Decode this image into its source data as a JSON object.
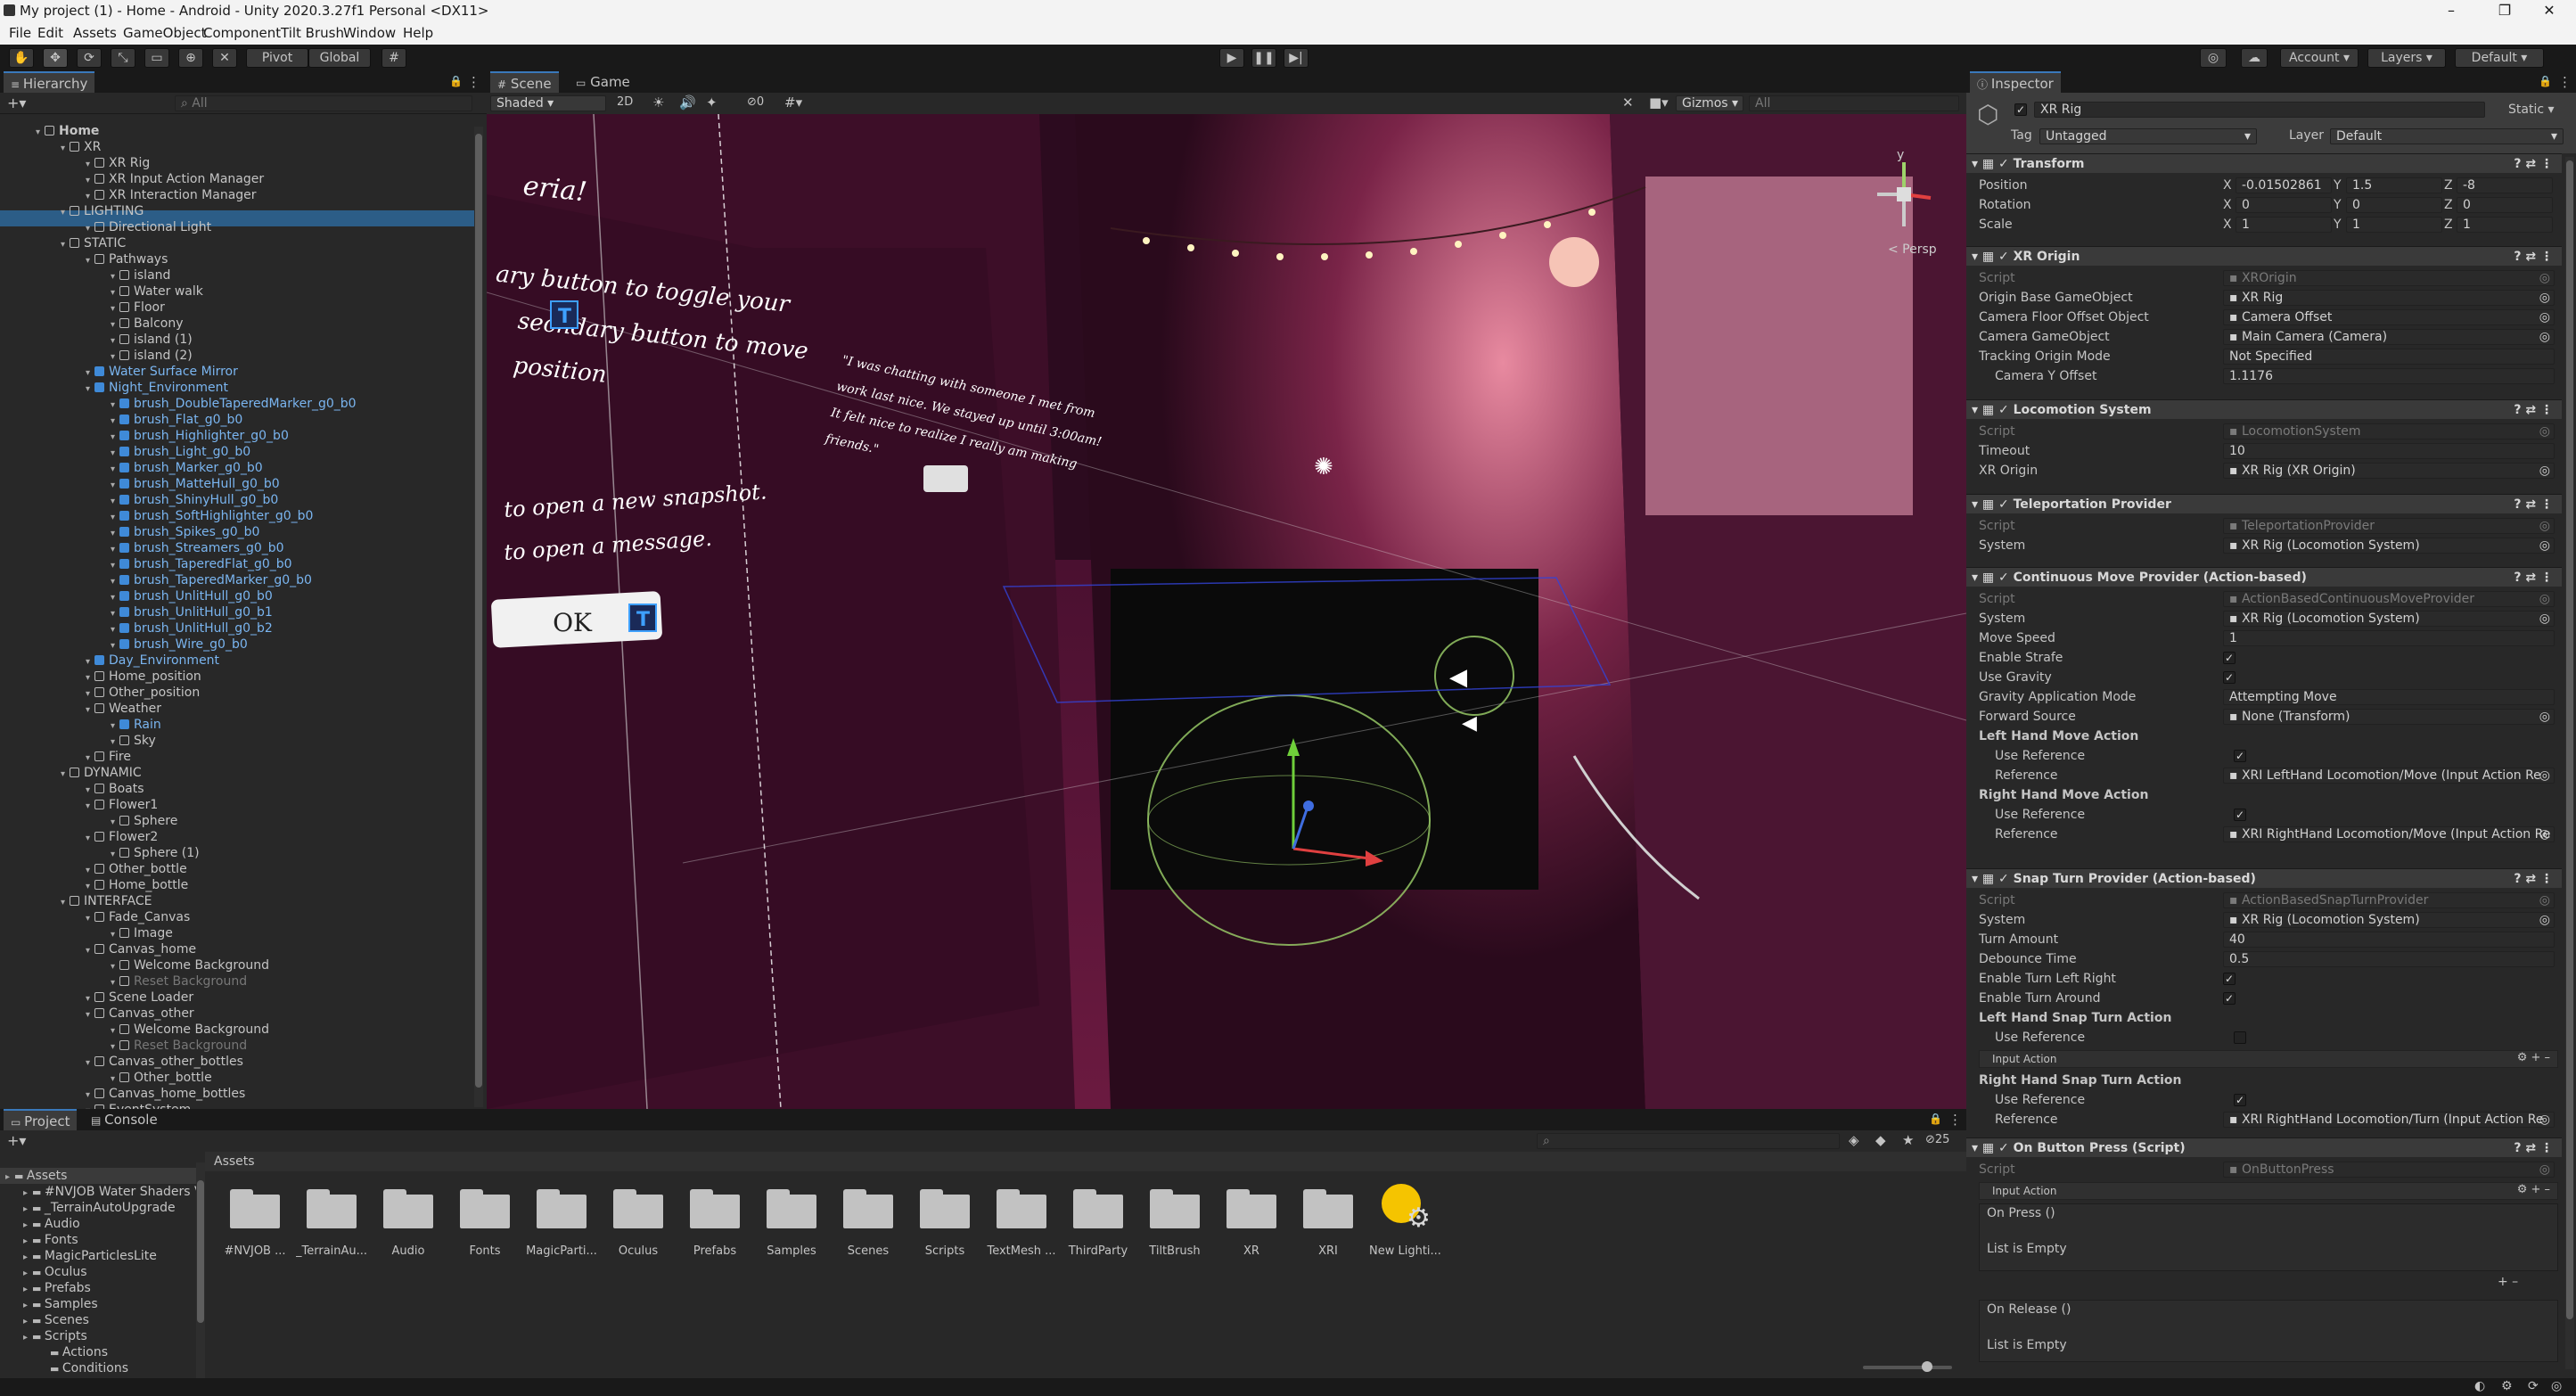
{
  "window": {
    "title": "My project (1) - Home - Android - Unity 2020.3.27f1 Personal <DX11>"
  },
  "menu": [
    "File",
    "Edit",
    "Assets",
    "GameObject",
    "Component",
    "Tilt Brush",
    "Window",
    "Help"
  ],
  "toolbar": {
    "pivot": "Pivot",
    "global": "Global",
    "account": "Account",
    "layers": "Layers",
    "layout": "Default"
  },
  "hierarchy": {
    "tab": "Hierarchy",
    "search_placeholder": "All",
    "rows": [
      {
        "t": "Home",
        "i": 0,
        "b": 1
      },
      {
        "t": "XR",
        "i": 1
      },
      {
        "t": "XR Rig",
        "i": 2,
        "s": 1
      },
      {
        "t": "XR Input Action Manager",
        "i": 2
      },
      {
        "t": "XR Interaction Manager",
        "i": 2
      },
      {
        "t": "LIGHTING",
        "i": 1
      },
      {
        "t": "Directional Light",
        "i": 2
      },
      {
        "t": "STATIC",
        "i": 1
      },
      {
        "t": "Pathways",
        "i": 2
      },
      {
        "t": "island",
        "i": 3
      },
      {
        "t": "Water walk",
        "i": 3
      },
      {
        "t": "Floor",
        "i": 3
      },
      {
        "t": "Balcony",
        "i": 3
      },
      {
        "t": "island (1)",
        "i": 3
      },
      {
        "t": "island (2)",
        "i": 3
      },
      {
        "t": "Water Surface Mirror",
        "i": 2,
        "c": "blue"
      },
      {
        "t": "Night_Environment",
        "i": 2,
        "c": "blue"
      },
      {
        "t": "brush_DoubleTaperedMarker_g0_b0",
        "i": 3,
        "c": "blue"
      },
      {
        "t": "brush_Flat_g0_b0",
        "i": 3,
        "c": "blue"
      },
      {
        "t": "brush_Highlighter_g0_b0",
        "i": 3,
        "c": "blue"
      },
      {
        "t": "brush_Light_g0_b0",
        "i": 3,
        "c": "blue"
      },
      {
        "t": "brush_Marker_g0_b0",
        "i": 3,
        "c": "blue"
      },
      {
        "t": "brush_MatteHull_g0_b0",
        "i": 3,
        "c": "blue"
      },
      {
        "t": "brush_ShinyHull_g0_b0",
        "i": 3,
        "c": "blue"
      },
      {
        "t": "brush_SoftHighlighter_g0_b0",
        "i": 3,
        "c": "blue"
      },
      {
        "t": "brush_Spikes_g0_b0",
        "i": 3,
        "c": "blue"
      },
      {
        "t": "brush_Streamers_g0_b0",
        "i": 3,
        "c": "blue"
      },
      {
        "t": "brush_TaperedFlat_g0_b0",
        "i": 3,
        "c": "blue"
      },
      {
        "t": "brush_TaperedMarker_g0_b0",
        "i": 3,
        "c": "blue"
      },
      {
        "t": "brush_UnlitHull_g0_b0",
        "i": 3,
        "c": "blue"
      },
      {
        "t": "brush_UnlitHull_g0_b1",
        "i": 3,
        "c": "blue"
      },
      {
        "t": "brush_UnlitHull_g0_b2",
        "i": 3,
        "c": "blue"
      },
      {
        "t": "brush_Wire_g0_b0",
        "i": 3,
        "c": "blue"
      },
      {
        "t": "Day_Environment",
        "i": 2,
        "c": "blue"
      },
      {
        "t": "Home_position",
        "i": 2
      },
      {
        "t": "Other_position",
        "i": 2
      },
      {
        "t": "Weather",
        "i": 2
      },
      {
        "t": "Rain",
        "i": 3,
        "c": "blue"
      },
      {
        "t": "Sky",
        "i": 3
      },
      {
        "t": "Fire",
        "i": 2
      },
      {
        "t": "DYNAMIC",
        "i": 1
      },
      {
        "t": "Boats",
        "i": 2
      },
      {
        "t": "Flower1",
        "i": 2
      },
      {
        "t": "Sphere",
        "i": 3
      },
      {
        "t": "Flower2",
        "i": 2
      },
      {
        "t": "Sphere (1)",
        "i": 3
      },
      {
        "t": "Other_bottle",
        "i": 2
      },
      {
        "t": "Home_bottle",
        "i": 2
      },
      {
        "t": "INTERFACE",
        "i": 1
      },
      {
        "t": "Fade_Canvas",
        "i": 2
      },
      {
        "t": "Image",
        "i": 3
      },
      {
        "t": "Canvas_home",
        "i": 2
      },
      {
        "t": "Welcome Background",
        "i": 3
      },
      {
        "t": "Reset Background",
        "i": 3,
        "c": "dim"
      },
      {
        "t": "Scene Loader",
        "i": 2
      },
      {
        "t": "Canvas_other",
        "i": 2
      },
      {
        "t": "Welcome Background",
        "i": 3
      },
      {
        "t": "Reset Background",
        "i": 3,
        "c": "dim"
      },
      {
        "t": "Canvas_other_bottles",
        "i": 2
      },
      {
        "t": "Other_bottle",
        "i": 3
      },
      {
        "t": "Canvas_home_bottles",
        "i": 2
      },
      {
        "t": "EventSystem",
        "i": 2
      }
    ]
  },
  "scene": {
    "tab_scene": "Scene",
    "tab_game": "Game",
    "shading": "Shaded",
    "mode_2d": "2D",
    "gizmos": "Gizmos",
    "search_placeholder": "All",
    "hidden_count": "0",
    "persp": "< Persp",
    "texts": [
      "eria!",
      "ary button to toggle your",
      "secndary button to move",
      "position",
      "to open a new snapshot.",
      "to open a message.",
      "OK"
    ],
    "note": [
      "\"I was chatting with someone I met from",
      "work last nice. We stayed up until 3:00am!",
      "It felt nice to realize I really am making",
      "friends.\""
    ]
  },
  "inspector": {
    "tab": "Inspector",
    "object_name": "XR Rig",
    "static": "Static",
    "tag_label": "Tag",
    "tag": "Untagged",
    "layer_label": "Layer",
    "layer": "Default",
    "transform": {
      "title": "Transform",
      "position": "Position",
      "rotation": "Rotation",
      "scale": "Scale",
      "px": "-0.01502861",
      "py": "1.5",
      "pz": "-8",
      "rx": "0",
      "ry": "0",
      "rz": "0",
      "sx": "1",
      "sy": "1",
      "sz": "1"
    },
    "xr_origin": {
      "title": "XR Origin",
      "script_l": "Script",
      "script": "XROrigin",
      "r1": "Origin Base GameObject",
      "v1": "XR Rig",
      "r2": "Camera Floor Offset Object",
      "v2": "Camera Offset",
      "r3": "Camera GameObject",
      "v3": "Main Camera (Camera)",
      "r4": "Tracking Origin Mode",
      "v4": "Not Specified",
      "r5": "Camera Y Offset",
      "v5": "1.1176"
    },
    "locomotion": {
      "title": "Locomotion System",
      "script_l": "Script",
      "script": "LocomotionSystem",
      "r1": "Timeout",
      "v1": "10",
      "r2": "XR Origin",
      "v2": "XR Rig (XR Origin)"
    },
    "teleport": {
      "title": "Teleportation Provider",
      "script_l": "Script",
      "script": "TeleportationProvider",
      "r1": "System",
      "v1": "XR Rig (Locomotion System)"
    },
    "move": {
      "title": "Continuous Move Provider (Action-based)",
      "script_l": "Script",
      "script": "ActionBasedContinuousMoveProvider",
      "r1": "System",
      "v1": "XR Rig (Locomotion System)",
      "r2": "Move Speed",
      "v2": "1",
      "r3": "Enable Strafe",
      "r4": "Use Gravity",
      "r5": "Gravity Application Mode",
      "v5": "Attempting Move",
      "r6": "Forward Source",
      "v6": "None (Transform)",
      "h1": "Left Hand Move Action",
      "r7": "Use Reference",
      "r8": "Reference",
      "v8": "XRI LeftHand Locomotion/Move (Input Action Re",
      "h2": "Right Hand Move Action",
      "r9": "Use Reference",
      "r10": "Reference",
      "v10": "XRI RightHand Locomotion/Move (Input Action Re"
    },
    "snap": {
      "title": "Snap Turn Provider (Action-based)",
      "script_l": "Script",
      "script": "ActionBasedSnapTurnProvider",
      "r1": "System",
      "v1": "XR Rig (Locomotion System)",
      "r2": "Turn Amount",
      "v2": "40",
      "r3": "Debounce Time",
      "v3": "0.5",
      "r4": "Enable Turn Left Right",
      "r5": "Enable Turn Around",
      "h1": "Left Hand Snap Turn Action",
      "r6": "Use Reference",
      "r7": "Input Action",
      "h2": "Right Hand Snap Turn Action",
      "r8": "Use Reference",
      "r9": "Reference",
      "v9": "XRI RightHand Locomotion/Turn (Input Action Re"
    },
    "button": {
      "title": "On Button Press (Script)",
      "script_l": "Script",
      "script": "OnButtonPress",
      "r1": "Input Action",
      "r2": "On Press ()",
      "r3": "List is Empty",
      "r4": "On Release ()",
      "r5": "List is Empty"
    }
  },
  "project": {
    "tab_project": "Project",
    "tab_console": "Console",
    "breadcrumb": "Assets",
    "count": "25",
    "tree": [
      {
        "t": "Assets",
        "i": 0
      },
      {
        "t": "#NVJOB Water Shaders V",
        "i": 1
      },
      {
        "t": "_TerrainAutoUpgrade",
        "i": 1
      },
      {
        "t": "Audio",
        "i": 1
      },
      {
        "t": "Fonts",
        "i": 1
      },
      {
        "t": "MagicParticlesLite",
        "i": 1
      },
      {
        "t": "Oculus",
        "i": 1
      },
      {
        "t": "Prefabs",
        "i": 1
      },
      {
        "t": "Samples",
        "i": 1
      },
      {
        "t": "Scenes",
        "i": 1
      },
      {
        "t": "Scripts",
        "i": 1
      },
      {
        "t": "Actions",
        "i": 2
      },
      {
        "t": "Conditions",
        "i": 2
      }
    ],
    "folders": [
      "#NVJOB ...",
      "_TerrainAu...",
      "Audio",
      "Fonts",
      "MagicParti...",
      "Oculus",
      "Prefabs",
      "Samples",
      "Scenes",
      "Scripts",
      "TextMesh ...",
      "ThirdParty",
      "TiltBrush",
      "XR",
      "XRI"
    ],
    "lighting_asset": "New Lighti..."
  },
  "colors": {
    "selection": "#2c5d87",
    "accent": "#3a79bb",
    "prefab": "#7ab5f0"
  }
}
